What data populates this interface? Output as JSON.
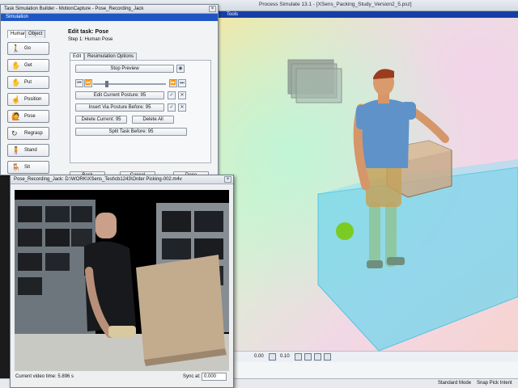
{
  "app": {
    "title": "Process Simulate 13.1 - [XSens_Packing_Study_Version2_5.psz]",
    "toolbar_label": "Tools"
  },
  "task_builder": {
    "title": "Task Simulation Builder - MotionCapture - Pose_Recording_Jack",
    "menu_label": "Simulation",
    "tabs": [
      {
        "label": "Human"
      },
      {
        "label": "Object"
      }
    ],
    "actions": [
      {
        "label": "Go",
        "icon": "walk-icon"
      },
      {
        "label": "Get",
        "icon": "get-icon"
      },
      {
        "label": "Put",
        "icon": "put-icon"
      },
      {
        "label": "Position",
        "icon": "position-icon"
      },
      {
        "label": "Pose",
        "icon": "pose-icon"
      },
      {
        "label": "Regrasp",
        "icon": "regrasp-icon"
      },
      {
        "label": "Stand",
        "icon": "stand-icon"
      },
      {
        "label": "Sit",
        "icon": "sit-icon"
      }
    ],
    "edit": {
      "heading": "Edit task: Pose",
      "step": "Step 1: Human Pose",
      "subtabs": [
        {
          "label": "Edit"
        },
        {
          "label": "Resimulation Options"
        }
      ],
      "stop_preview": "Stop Preview",
      "edit_current": "Edit Current Posture: 95",
      "insert_before": "Insert Via Posture Before: 95",
      "delete_current": "Delete Current: 95",
      "delete_all": "Delete All",
      "split_task": "Split Task Before: 95",
      "slider_position": 0.18
    },
    "footer": {
      "back": "Back",
      "cancel": "Cancel",
      "done": "Done"
    }
  },
  "video": {
    "title": "Pose_Recording_Jack: D:\\WORK\\XSens_Test\\cb1243\\Order Picking-002.m4v",
    "time_label": "Current video time: 5.896 s",
    "sync_label": "Sync at:",
    "sync_value": "0.000"
  },
  "viewport_toolbar": {
    "value1": "0.00",
    "value2": "0.10"
  },
  "status": {
    "mode": "Standard Mode",
    "pick": "Snap Pick Intent"
  },
  "colors": {
    "accent_blue": "#1f56c4",
    "floor_cyan": "#79d9ee",
    "marker_green": "#78c800"
  }
}
